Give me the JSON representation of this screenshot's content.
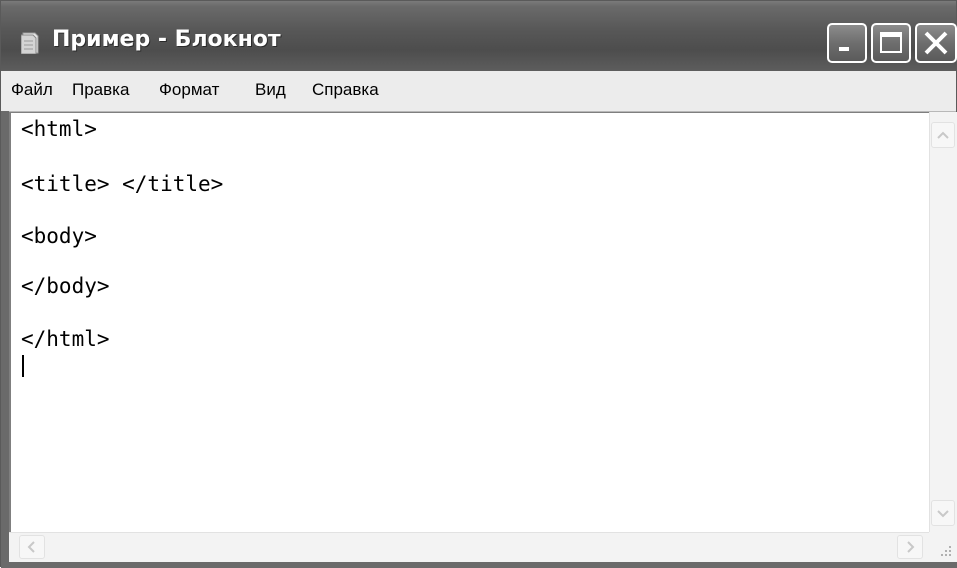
{
  "window": {
    "title": "Пример - Блокнот",
    "app_icon": "notepad-icon"
  },
  "titlebar_buttons": {
    "minimize_icon": "minimize-icon",
    "maximize_icon": "maximize-icon",
    "close_icon": "close-icon"
  },
  "menu": {
    "items": [
      {
        "label": "Файл"
      },
      {
        "label": "Правка"
      },
      {
        "label": "Формат"
      },
      {
        "label": "Вид"
      },
      {
        "label": "Справка"
      }
    ]
  },
  "editor": {
    "lines": [
      "<html>",
      "<title> </title>",
      "<body>",
      "</body>",
      "</html>"
    ]
  },
  "scrollbars": {
    "up_icon": "arrow-up-icon",
    "down_icon": "arrow-down-icon",
    "left_icon": "arrow-left-icon",
    "right_icon": "arrow-right-icon",
    "grip_icon": "size-grip-icon"
  },
  "colors": {
    "titlebar": "#585858",
    "menubar": "#ececec",
    "editor_bg": "#ffffff"
  }
}
